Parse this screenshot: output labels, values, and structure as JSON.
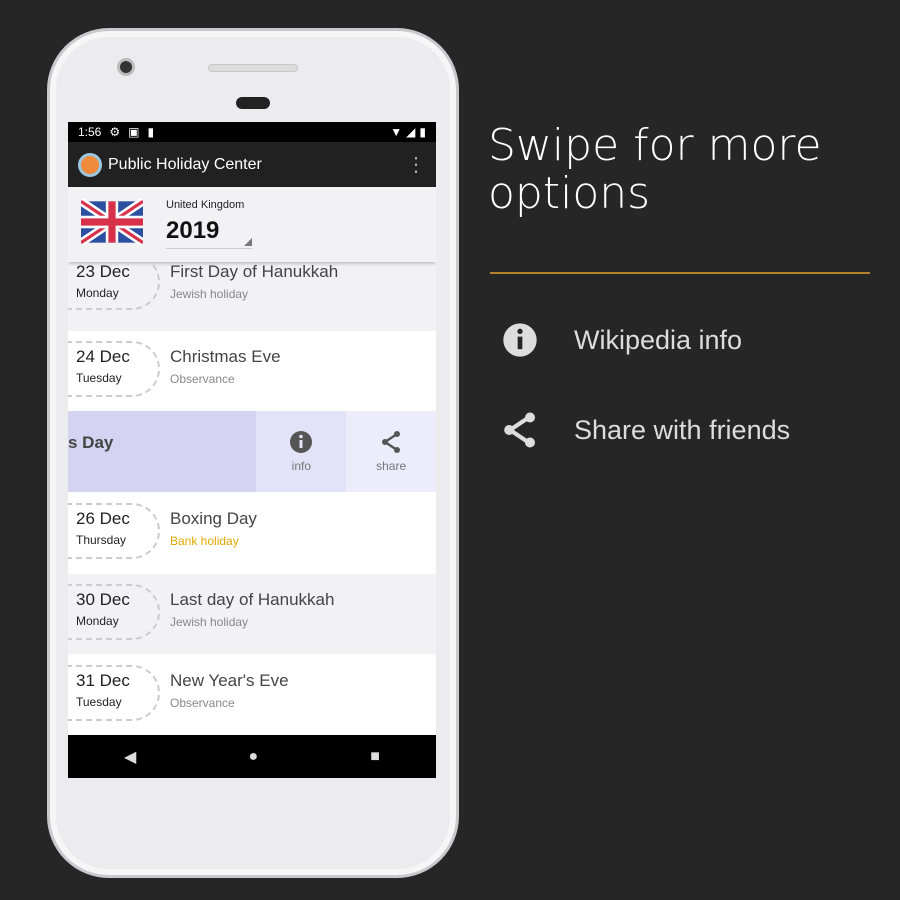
{
  "status": {
    "time": "1:56"
  },
  "app": {
    "title": "Public Holiday Center"
  },
  "header": {
    "country": "United Kingdom",
    "year": "2019"
  },
  "rows": [
    {
      "date": "23 Dec",
      "day": "Monday",
      "name": "First Day of Hanukkah",
      "type": "Jewish holiday"
    },
    {
      "date": "24 Dec",
      "day": "Tuesday",
      "name": "Christmas Eve",
      "type": "Observance"
    },
    {
      "date": "26 Dec",
      "day": "Thursday",
      "name": "Boxing Day",
      "type": "Bank holiday",
      "type_color": "#e0a800"
    },
    {
      "date": "30 Dec",
      "day": "Monday",
      "name": "Last day of Hanukkah",
      "type": "Jewish holiday"
    },
    {
      "date": "31 Dec",
      "day": "Tuesday",
      "name": "New Year's Eve",
      "type": "Observance"
    }
  ],
  "swiped": {
    "name": "s Day",
    "info": "info",
    "share": "share"
  },
  "promo": {
    "title": "Swipe for more options",
    "options": [
      {
        "icon": "info-icon",
        "label": "Wikipedia info"
      },
      {
        "icon": "share-icon",
        "label": "Share with friends"
      }
    ],
    "accent": "#b5832a"
  }
}
